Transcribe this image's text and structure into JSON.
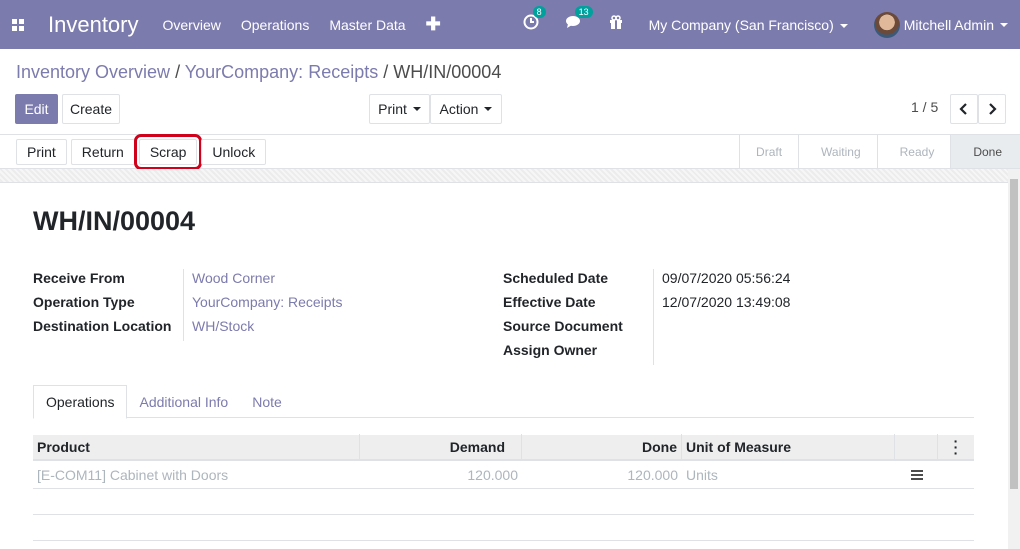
{
  "navbar": {
    "app_title": "Inventory",
    "menu": [
      "Overview",
      "Operations",
      "Master Data"
    ],
    "plus": "✚",
    "activity_count": "8",
    "messages_count": "13",
    "company": "My Company (San Francisco)",
    "user": "Mitchell Admin"
  },
  "breadcrumb": {
    "items": [
      "Inventory Overview",
      "YourCompany: Receipts"
    ],
    "separator": "/",
    "current": "WH/IN/00004"
  },
  "control": {
    "edit": "Edit",
    "create": "Create",
    "print": "Print",
    "action": "Action",
    "pager": "1 / 5"
  },
  "statusbar": {
    "buttons": [
      "Print",
      "Return",
      "Scrap",
      "Unlock"
    ],
    "stages": [
      "Draft",
      "Waiting",
      "Ready",
      "Done"
    ],
    "current_stage": "Done"
  },
  "record": {
    "title": "WH/IN/00004",
    "left_fields": [
      {
        "label": "Receive From",
        "value": "Wood Corner"
      },
      {
        "label": "Operation Type",
        "value": "YourCompany: Receipts"
      },
      {
        "label": "Destination Location",
        "value": "WH/Stock"
      }
    ],
    "right_fields": [
      {
        "label": "Scheduled Date",
        "value": "09/07/2020 05:56:24"
      },
      {
        "label": "Effective Date",
        "value": "12/07/2020 13:49:08"
      },
      {
        "label": "Source Document",
        "value": ""
      },
      {
        "label": "Assign Owner",
        "value": ""
      }
    ]
  },
  "tabs": [
    "Operations",
    "Additional Info",
    "Note"
  ],
  "table": {
    "headers": [
      "Product",
      "Demand",
      "Done",
      "Unit of Measure"
    ],
    "rows": [
      {
        "product": "[E-COM11] Cabinet with Doors",
        "demand": "120.000",
        "done": "120.000",
        "uom": "Units"
      }
    ]
  },
  "colors": {
    "brand": "#7c7bad",
    "highlight": "#d0021b"
  }
}
